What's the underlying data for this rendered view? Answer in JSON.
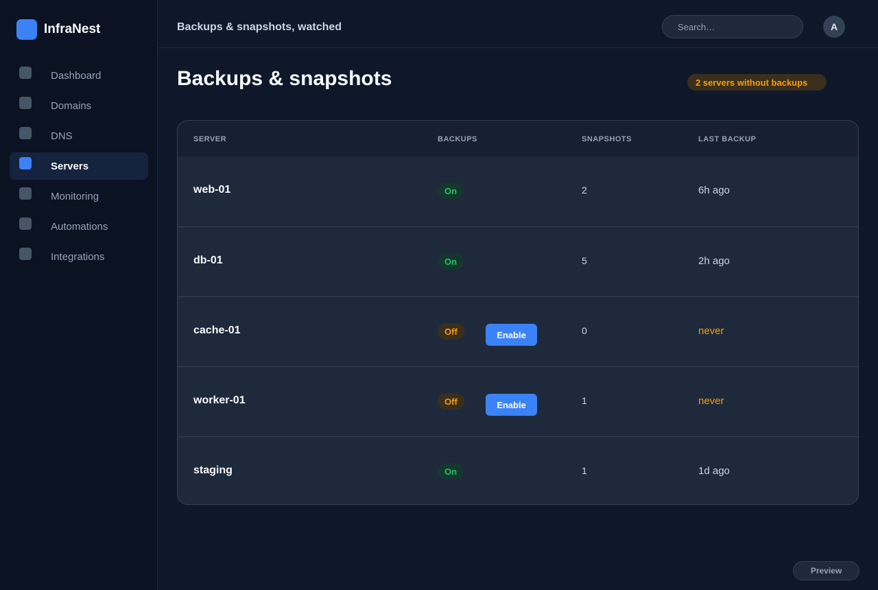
{
  "app": {
    "name": "InfraNest"
  },
  "sidebar": {
    "items": [
      {
        "label": "Dashboard",
        "icon": "dashboard-icon",
        "active": false
      },
      {
        "label": "Domains",
        "icon": "domains-icon",
        "active": false
      },
      {
        "label": "DNS",
        "icon": "dns-icon",
        "active": false
      },
      {
        "label": "Servers",
        "icon": "servers-icon",
        "active": true
      },
      {
        "label": "Monitoring",
        "icon": "monitoring-icon",
        "active": false
      },
      {
        "label": "Automations",
        "icon": "automations-icon",
        "active": false
      },
      {
        "label": "Integrations",
        "icon": "integrations-icon",
        "active": false
      }
    ]
  },
  "topbar": {
    "title": "Backups & snapshots, watched",
    "search_placeholder": "Search…",
    "avatar_initial": "A"
  },
  "main": {
    "title": "Backups & snapshots",
    "warning_badge": "2 servers without backups"
  },
  "table": {
    "columns": [
      "SERVER",
      "BACKUPS",
      "SNAPSHOTS",
      "LAST BACKUP"
    ],
    "rows": [
      {
        "server": "web-01",
        "backups": "On",
        "enable_label": "",
        "snapshots": "2",
        "last_backup": "6h ago"
      },
      {
        "server": "db-01",
        "backups": "On",
        "enable_label": "",
        "snapshots": "5",
        "last_backup": "2h ago"
      },
      {
        "server": "cache-01",
        "backups": "Off",
        "enable_label": "Enable",
        "snapshots": "0",
        "last_backup": "never"
      },
      {
        "server": "worker-01",
        "backups": "Off",
        "enable_label": "Enable",
        "snapshots": "1",
        "last_backup": "never"
      },
      {
        "server": "staging",
        "backups": "On",
        "enable_label": "",
        "snapshots": "1",
        "last_backup": "1d ago"
      }
    ]
  },
  "footer": {
    "preview_label": "Preview"
  },
  "colors": {
    "accent": "#3b82f6",
    "success": "#22c55e",
    "warning": "#f59e0b",
    "background": "#0f172a"
  }
}
